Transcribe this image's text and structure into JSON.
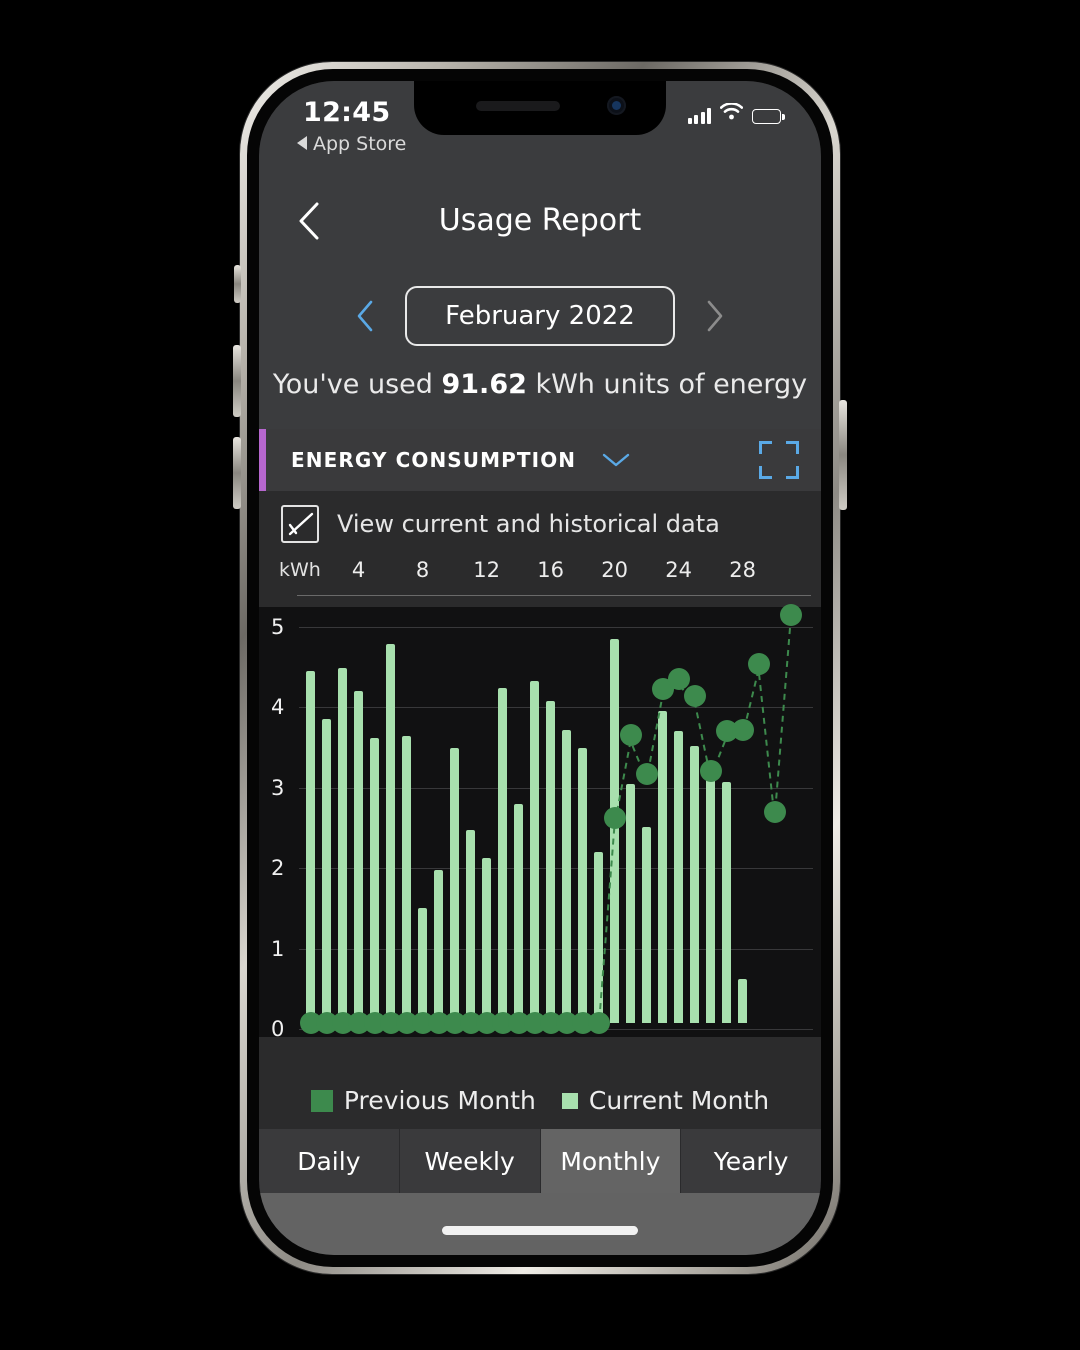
{
  "status_bar": {
    "time": "12:45",
    "back_app_label": "App Store",
    "back_app_icon": "triangle-left-icon",
    "signal_icon": "cellular-signal-icon",
    "wifi_icon": "wifi-icon",
    "battery_icon": "battery-icon"
  },
  "nav": {
    "back_icon": "chevron-left-icon",
    "title": "Usage Report"
  },
  "month_selector": {
    "prev_icon": "chevron-left-icon",
    "next_icon": "chevron-right-icon",
    "current": "February 2022",
    "prev_color": "#5aa9e6",
    "next_color": "#8c8c8c"
  },
  "usage_summary": {
    "prefix": "You've used ",
    "value": "91.62",
    "suffix": " kWh units of energy"
  },
  "section": {
    "title": "ENERGY CONSUMPTION",
    "accent_color": "#b767cf",
    "chevron_icon": "chevron-down-icon",
    "chevron_color": "#5aa9e6",
    "expand_icon": "fullscreen-expand-icon",
    "expand_color": "#5aa9e6"
  },
  "checkbox": {
    "label": "View current and historical data",
    "checked": true,
    "check_icon": "checkmark-icon"
  },
  "legend": {
    "previous_label": "Previous Month",
    "current_label": "Current Month",
    "previous_color": "#3d8a4d",
    "current_color": "#a8e0ae"
  },
  "tabs": [
    {
      "label": "Daily",
      "active": false
    },
    {
      "label": "Weekly",
      "active": false
    },
    {
      "label": "Monthly",
      "active": true
    },
    {
      "label": "Yearly",
      "active": false
    }
  ],
  "chart_data": {
    "type": "bar",
    "title": "ENERGY CONSUMPTION",
    "xlabel": "kWh",
    "ylabel": "",
    "grid": true,
    "legend_position": "bottom",
    "ylim": [
      0,
      5
    ],
    "yticks": [
      0,
      1,
      2,
      3,
      4,
      5
    ],
    "xticks": [
      4,
      8,
      12,
      16,
      20,
      24,
      28
    ],
    "categories": [
      1,
      2,
      3,
      4,
      5,
      6,
      7,
      8,
      9,
      10,
      11,
      12,
      13,
      14,
      15,
      16,
      17,
      18,
      19,
      20,
      21,
      22,
      23,
      24,
      25,
      26,
      27,
      28
    ],
    "series": [
      {
        "name": "Current Month",
        "type": "bar",
        "color": "#a8e0ae",
        "values": [
          4.38,
          3.78,
          4.42,
          4.13,
          3.55,
          4.72,
          3.57,
          1.43,
          1.9,
          3.42,
          2.4,
          2.05,
          4.17,
          2.73,
          4.25,
          4.0,
          3.64,
          3.42,
          2.13,
          4.78,
          2.97,
          2.44,
          3.88,
          3.63,
          3.45,
          3.03,
          3.0,
          0.55
        ]
      },
      {
        "name": "Previous Month",
        "type": "line-markers",
        "color": "#3d8a4d",
        "line_style": "dashed",
        "values": [
          0,
          0,
          0,
          0,
          0,
          0,
          0,
          0,
          0,
          0,
          0,
          0,
          0,
          0,
          0,
          0,
          0,
          0,
          0,
          2.55,
          3.58,
          3.1,
          4.15,
          4.28,
          4.07,
          3.13,
          3.63,
          3.65,
          4.47,
          2.62,
          5.08
        ]
      }
    ]
  }
}
